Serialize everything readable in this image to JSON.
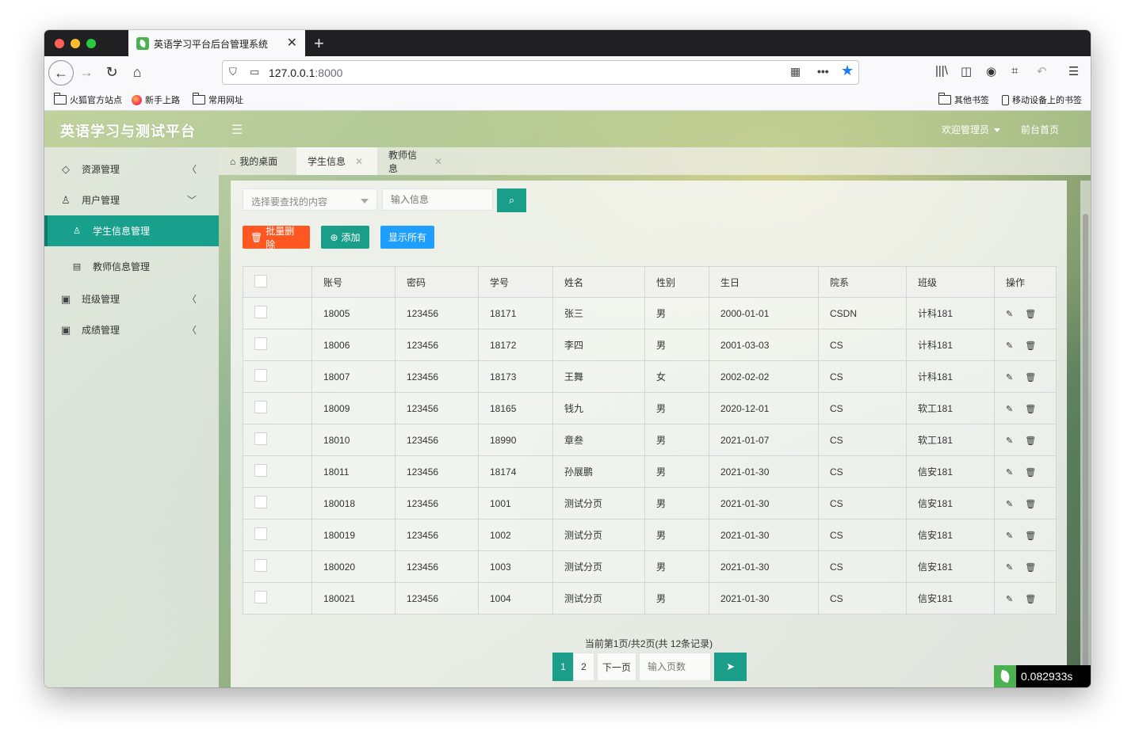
{
  "browser": {
    "tab_title": "英语学习平台后台管理系统",
    "url_host": "127.0.0.1",
    "url_port": ":8000",
    "bookmarks_left": [
      "火狐官方站点",
      "新手上路",
      "常用网址"
    ],
    "bookmarks_right": [
      "其他书签",
      "移动设备上的书签"
    ]
  },
  "app": {
    "logo": "英语学习与测试平台",
    "welcome": "欢迎管理员",
    "front_link": "前台首页"
  },
  "sidebar": {
    "items": [
      {
        "label": "资源管理",
        "icon": "diamond-icon"
      },
      {
        "label": "用户管理",
        "icon": "user-icon"
      },
      {
        "label": "学生信息管理",
        "icon": "user-small-icon"
      },
      {
        "label": "教师信息管理",
        "icon": "id-card-icon"
      },
      {
        "label": "班级管理",
        "icon": "form-icon"
      },
      {
        "label": "成绩管理",
        "icon": "form-icon"
      }
    ]
  },
  "content_tabs": [
    {
      "label": "我的桌面"
    },
    {
      "label": "学生信息"
    },
    {
      "label": "教师信息"
    }
  ],
  "search": {
    "select_placeholder": "选择要查找的内容",
    "input_placeholder": "输入信息"
  },
  "actions": {
    "batch_delete": "批量删除",
    "add": "添加",
    "show_all": "显示所有"
  },
  "table": {
    "columns": [
      "账号",
      "密码",
      "学号",
      "姓名",
      "性别",
      "生日",
      "院系",
      "班级",
      "操作"
    ],
    "rows": [
      [
        "18005",
        "123456",
        "18171",
        "张三",
        "男",
        "2000-01-01",
        "CSDN",
        "计科181"
      ],
      [
        "18006",
        "123456",
        "18172",
        "李四",
        "男",
        "2001-03-03",
        "CS",
        "计科181"
      ],
      [
        "18007",
        "123456",
        "18173",
        "王舞",
        "女",
        "2002-02-02",
        "CS",
        "计科181"
      ],
      [
        "18009",
        "123456",
        "18165",
        "钱九",
        "男",
        "2020-12-01",
        "CS",
        "软工181"
      ],
      [
        "18010",
        "123456",
        "18990",
        "章叁",
        "男",
        "2021-01-07",
        "CS",
        "软工181"
      ],
      [
        "18011",
        "123456",
        "18174",
        "孙展鹏",
        "男",
        "2021-01-30",
        "CS",
        "信安181"
      ],
      [
        "180018",
        "123456",
        "1001",
        "测试分页",
        "男",
        "2021-01-30",
        "CS",
        "信安181"
      ],
      [
        "180019",
        "123456",
        "1002",
        "测试分页",
        "男",
        "2021-01-30",
        "CS",
        "信安181"
      ],
      [
        "180020",
        "123456",
        "1003",
        "测试分页",
        "男",
        "2021-01-30",
        "CS",
        "信安181"
      ],
      [
        "180021",
        "123456",
        "1004",
        "测试分页",
        "男",
        "2021-01-30",
        "CS",
        "信安181"
      ]
    ]
  },
  "pagination": {
    "info": "当前第1页/共2页(共 12条记录)",
    "pages": [
      "1",
      "2"
    ],
    "next": "下一页",
    "input_placeholder": "输入页数"
  },
  "timer": "0.082933s",
  "colors": {
    "accent": "#1a9e8a",
    "danger": "#ff5722",
    "info": "#1e9fff"
  }
}
